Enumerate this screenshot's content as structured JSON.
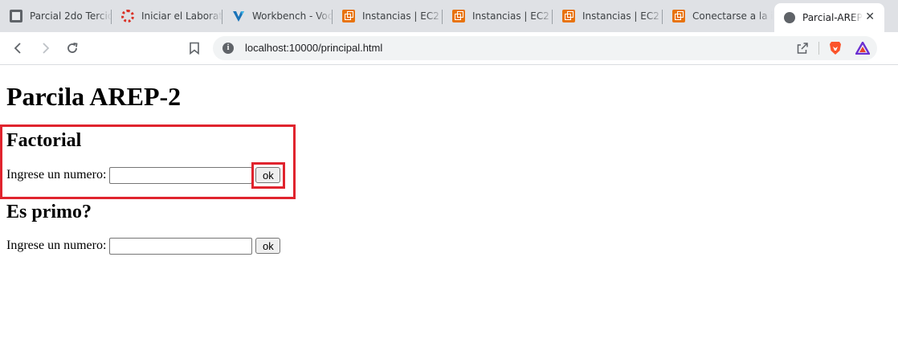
{
  "browser": {
    "tabs": [
      {
        "title": "Parcial 2do Tercio",
        "favicon": "document-icon",
        "active": false
      },
      {
        "title": "Iniciar el Laboratorio",
        "favicon": "learner-lab-icon",
        "active": false
      },
      {
        "title": "Workbench - Vocareum",
        "favicon": "vocareum-icon",
        "active": false
      },
      {
        "title": "Instancias | EC2 | us-east-1",
        "favicon": "aws-ec2-icon",
        "active": false
      },
      {
        "title": "Instancias | EC2 | us-east-1",
        "favicon": "aws-ec2-icon",
        "active": false
      },
      {
        "title": "Instancias | EC2 | us-east-1",
        "favicon": "aws-ec2-icon",
        "active": false
      },
      {
        "title": "Conectarse a la instancia",
        "favicon": "aws-ec2-icon",
        "active": false
      },
      {
        "title": "Parcial-AREP",
        "favicon": "globe-icon",
        "active": true
      }
    ],
    "close_glyph": "✕",
    "address_bar": {
      "url": "localhost:10000/principal.html"
    },
    "colors": {
      "accent_highlight": "#e0242e",
      "brave": "#fb542b"
    }
  },
  "page": {
    "title": "Parcila AREP-2",
    "sections": [
      {
        "heading": "Factorial",
        "label": "Ingrese un numero:",
        "input_value": "",
        "button_label": "ok"
      },
      {
        "heading": "Es primo?",
        "label": "Ingrese un numero:",
        "input_value": "",
        "button_label": "ok"
      }
    ]
  }
}
